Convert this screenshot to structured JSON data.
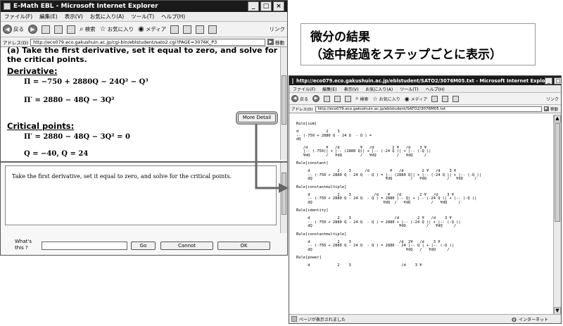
{
  "left_window": {
    "title": "E-Math EBL - Microsoft Internet Explorer",
    "menu": [
      "ファイル(F)",
      "編集(E)",
      "表示(V)",
      "お気に入り(A)",
      "ツール(T)",
      "ヘルプ(H)"
    ],
    "toolbar": {
      "back": "戻る",
      "search": "検索",
      "favorites": "お気に入り",
      "media": "メディア",
      "links": "リンク"
    },
    "address_label": "アドレス(D)",
    "address": "http://eco079.eco.gakushuin.ac.jp/cgi-bin/eblstudent/sato2.cgi?PAGE=3076K_P3",
    "go": "移動",
    "content": {
      "heading": "(a) Take the first derivative, set it equal to zero, and solve for the critical points.",
      "derivative_label": "Derivative:",
      "eq1": "Π = −750 + 2880Q − 24Q² − Q³",
      "eq2": "Π′ = 2880 − 48Q − 3Q²",
      "more_detail": "More Detail",
      "critical_label": "Critical points:",
      "eq3": "Π′ = 2880 − 48Q − 3Q² = 0",
      "eq4": "Q = −40, Q = 24"
    },
    "textarea": "Take the first derivative, set it equal to zero, and solve for the critical points.",
    "bottom": {
      "whats_this": "What's this ?",
      "go": "Go",
      "cannot": "Cannot",
      "ok": "OK"
    }
  },
  "callout": {
    "line1": "微分の結果",
    "line2": "（途中経過をステップごとに表示）"
  },
  "right_window": {
    "title": "http://eco079.eco.gakushuin.ac.jp/eblstudent/SATO2/3076M05.txt - Microsoft Internet Explo",
    "menu": [
      "ファイル(F)",
      "編集(E)",
      "表示(V)",
      "お気に入り(A)",
      "ツール(T)",
      "ヘルプ(H)"
    ],
    "toolbar": {
      "back": "戻る",
      "search": "検索",
      "favorites": "お気に入り",
      "media": "メディア",
      "links": "リンク"
    },
    "address_label": "アドレス(D)",
    "address": "http://eco079.eco.gakushuin.ac.jp/eblstudent/SATO2/3076M05.txt",
    "go": "移動",
    "text_content": "Rule[sum]\n\nd            2    3\n-- (-750 + 2880 Q - 24 Q  - Q ) =\ndQ\n\n   /d        ¥   /d         ¥   /d        2 ¥   /d    3 ¥\n   |-- (-750)| + |-- (2880 Q)| + |-- (-24 Q )| + |-- (-Q )|\n   ¥dQ       /   ¥dQ        /   ¥dQ         /   ¥dQ     /\n\nRule[constant]\n\n     d            2    3      /d         ¥   /d        2 ¥   /d    3 ¥\n     -- (-750 + 2880 Q - 24 Q  - Q ) = |-- (2880 Q)| + |-- (-24 Q )| + |-- (-Q )|\n     dQ                                ¥dQ        /   ¥dQ         /   ¥dQ     /\n\nRule[constantmultiple]\n\n     d            2    3          /d    ¥   /d        2 ¥   /d    3 ¥\n     -- (-750 + 2880 Q - 24 Q  - Q ) = 2880 |-- Q| + |-- (-24 Q )| + |-- (-Q )|\n     dQ                               ¥dQ  /   ¥dQ         /   ¥dQ     /\n\nRule[identity]\n\n     d            2    3                   /d        2 ¥   /d    3 ¥\n     -- (-750 + 2880 Q - 24 Q  - Q ) = 2880 + |-- (-24 Q )| + |-- (-Q )|\n     dQ                                      ¥dQ         /   ¥dQ     /\n\nRule[constantmultiple]\n\n     d            2    3                     /d  2¥   /d    3 ¥\n     -- (-750 + 2880 Q - 24 Q  - Q ) = 2880 - 24 |-- Q | + |-- (-Q )|\n     dQ                                         ¥dQ   /   ¥dQ     /\n\nRule[power]\n\n     d            2    3                      /d    3 ¥",
    "status_left": "ページが表示されました",
    "status_right": "インターネット"
  }
}
